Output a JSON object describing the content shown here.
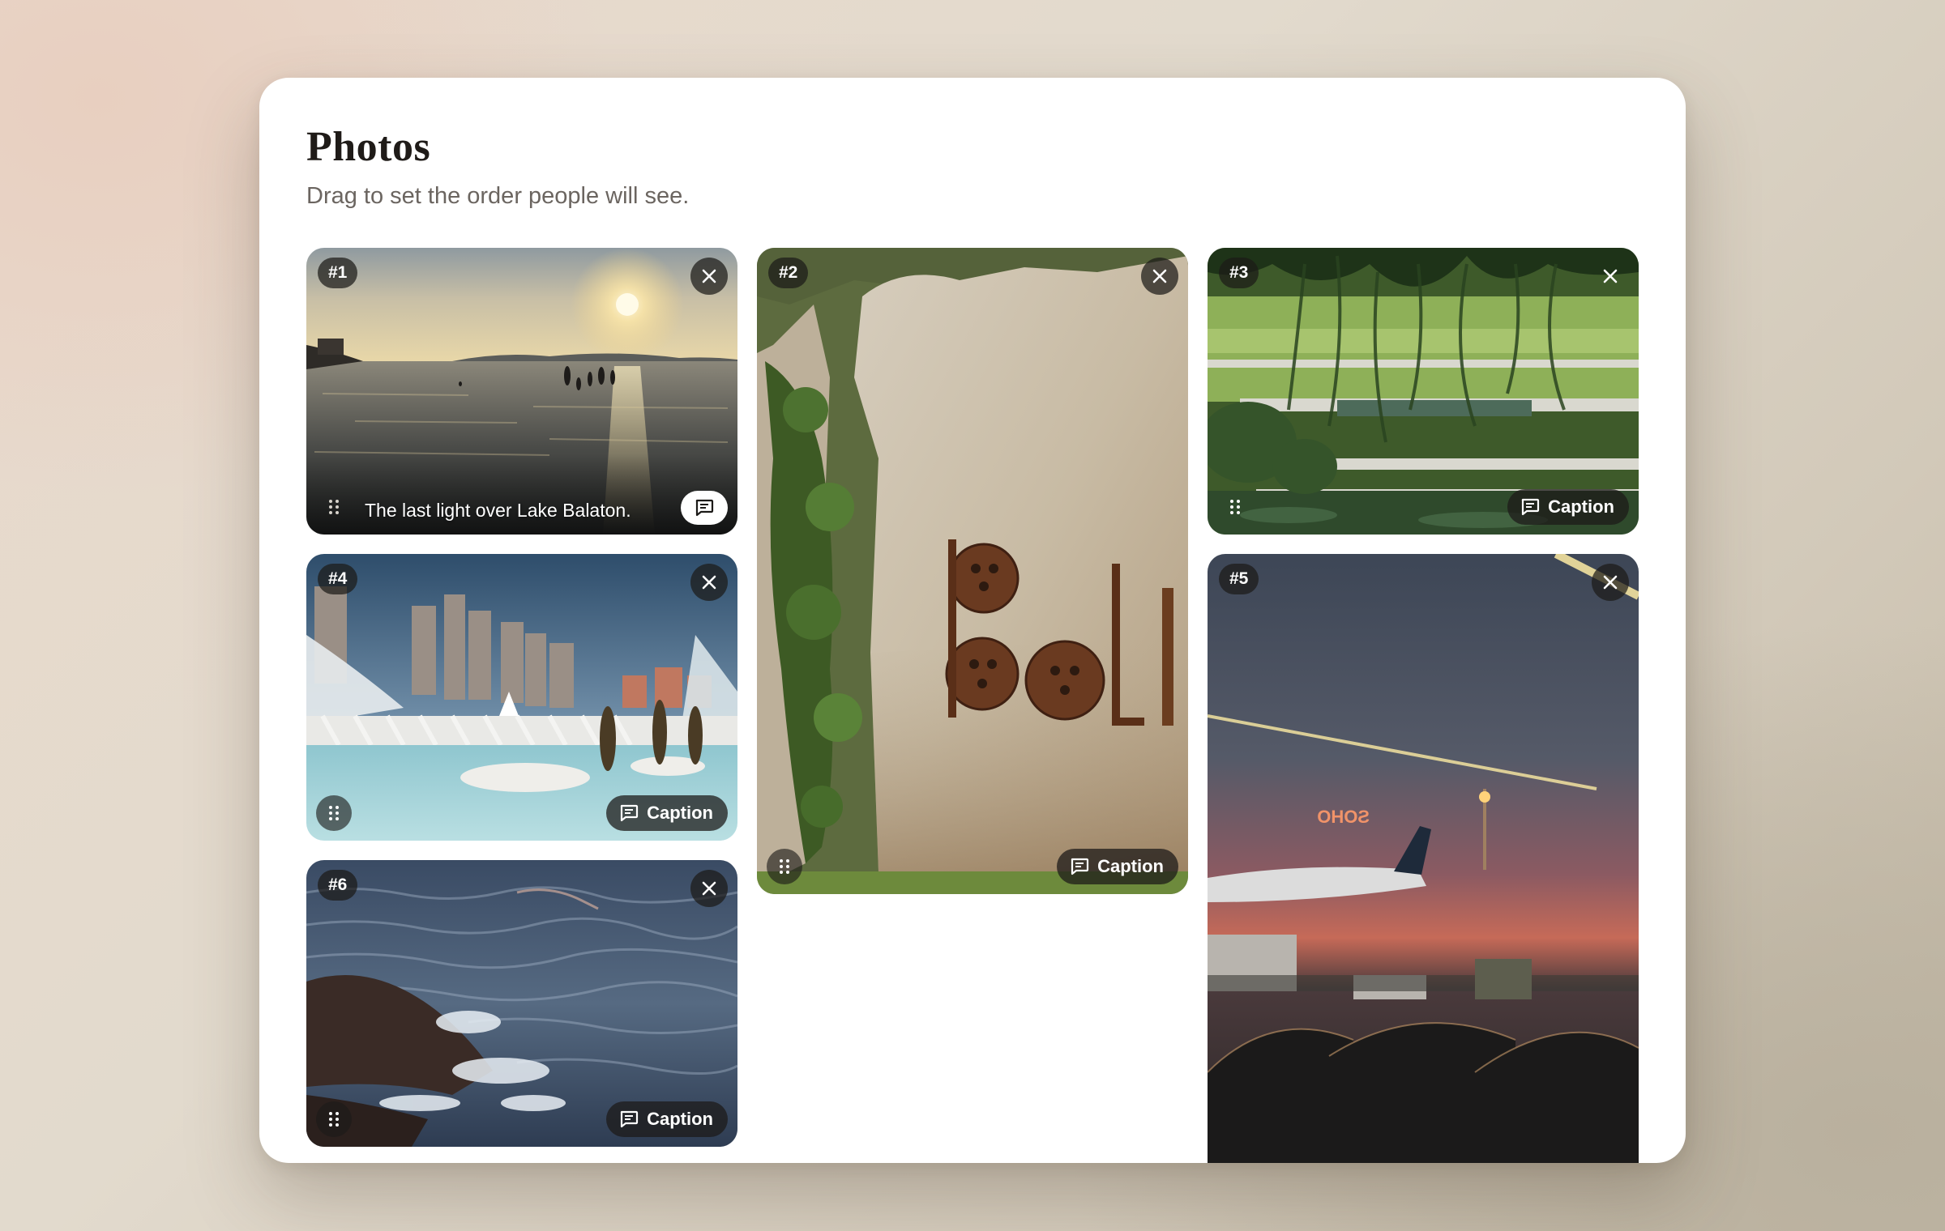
{
  "header": {
    "title": "Photos",
    "subtitle": "Drag to set the order people will see."
  },
  "photos": [
    {
      "number": "#1",
      "caption": "The last light over Lake Balaton.",
      "has_caption": true,
      "scene": "sunset-over-lake"
    },
    {
      "number": "#2",
      "caption_button_label": "Caption",
      "has_caption": false,
      "scene": "stone-wall-with-rusted-letters"
    },
    {
      "number": "#3",
      "caption_button_label": "Caption",
      "has_caption": false,
      "scene": "park-pond-under-willow"
    },
    {
      "number": "#4",
      "caption_button_label": "Caption",
      "has_caption": false,
      "scene": "futuristic-city-architecture-pool"
    },
    {
      "number": "#5",
      "has_caption": false,
      "scene": "airport-window-at-dusk"
    },
    {
      "number": "#6",
      "caption_button_label": "Caption",
      "has_caption": false,
      "scene": "waves-crashing-on-rocks"
    }
  ],
  "icons": {
    "close": "close-icon",
    "drag": "drag-handle-icon",
    "caption": "comment-icon"
  },
  "colors": {
    "overlay": "#1c1a18",
    "panel": "#ffffff",
    "title": "#1f1b18",
    "subtitle": "#6b6560"
  }
}
